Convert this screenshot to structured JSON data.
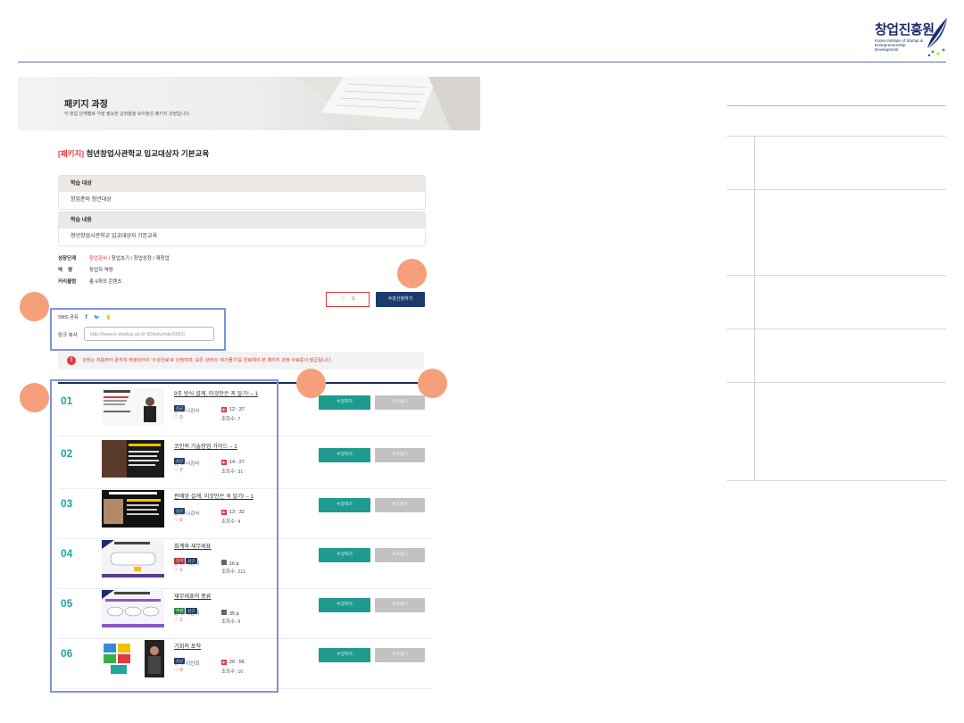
{
  "logo": {
    "name": "창업진흥원",
    "sub": "Korea Institute of Startup & Entrepreneurship Development"
  },
  "banner": {
    "title": "패키지 과정",
    "subtitle": "각 창업 단계별로 가장 필요한 강좌들을 모아놓은 패키지 과정입니다."
  },
  "course": {
    "tag": "[패키지]",
    "title": " 청년창업사관학교 입교대상자 기본교육"
  },
  "target": {
    "label": "학습 대상",
    "value": "창업준비 청년대상"
  },
  "content": {
    "label": "학습 내용",
    "value": "청년창업사관학교 입교대상자 기본교육"
  },
  "meta": {
    "stage_label": "성장단계",
    "stage_hl": "창업준비",
    "stage_rest": " / 창업초기 / 창업성장 / 재창업",
    "competency_label": "역    량",
    "competency": "창업자 역량",
    "curriculum_label": "커리큘럼",
    "curriculum": "총 6개의 콘텐츠"
  },
  "actions": {
    "like_icon": "♡",
    "like_count": "0",
    "apply": "수강신청하기"
  },
  "sns": {
    "label": "SNS 공유",
    "facebook": "f",
    "twitter": "🐦",
    "kakao": "▮"
  },
  "link": {
    "label": "링크 복사",
    "url": "http://www.k-startup.go.kr:80/edu/edu/0001/"
  },
  "notice": {
    "icon": "!",
    "text": "강좌는 처음부터 끝까지 재생되어야 '수강완료'로 인정되며, 모든 강좌의 '퀴즈풀기'를 완료해야 본 패키지 과정 수료증이 발급됩니다."
  },
  "list": {
    "study_label": "수강하기",
    "quiz_label": "퀴즈풀기",
    "items": [
      {
        "num": "01",
        "title": "9주 방식 설계, 이것만은 꼭 알기! – 1",
        "instructor": "강사: 나강사",
        "likes": "♡  0",
        "duration": "12 : 37",
        "views": "조회수: 7"
      },
      {
        "num": "02",
        "title": "코인의 기술창업 가이드 – 1",
        "instructor": "강사: 나강사",
        "likes": "♡  2",
        "duration": "14 : 27",
        "views": "조회수: 31"
      },
      {
        "num": "03",
        "title": "판매망 설계, 이것만은 꼭 알기! – 1",
        "instructor": "강사: 나강사",
        "likes": "♡  0",
        "duration": "13 : 32",
        "views": "조회수: 4"
      },
      {
        "num": "04",
        "title": "회계와 재무제표",
        "instructor": "강사: 나강사",
        "likes": "♡  1",
        "duration": "16 p",
        "views": "조회수: 211"
      },
      {
        "num": "05",
        "title": "재무제표의 종류",
        "instructor": "강사: 나강사",
        "likes": "♡  1",
        "duration": "35 p",
        "views": "조회수: 9"
      },
      {
        "num": "06",
        "title": "기회의 포착",
        "instructor": "강사: 이인희",
        "likes": "♡  0",
        "duration": "20 : 56",
        "views": "조회수: 10"
      }
    ],
    "badges": {
      "new": "신규",
      "popular": "인기",
      "recommend": "추천"
    }
  },
  "colors": {
    "accent": "#1f9a8e",
    "navy": "#1b3b6b",
    "red": "#e0383e",
    "annotation": "#f5a07a",
    "highlight": "#7f93d8"
  }
}
